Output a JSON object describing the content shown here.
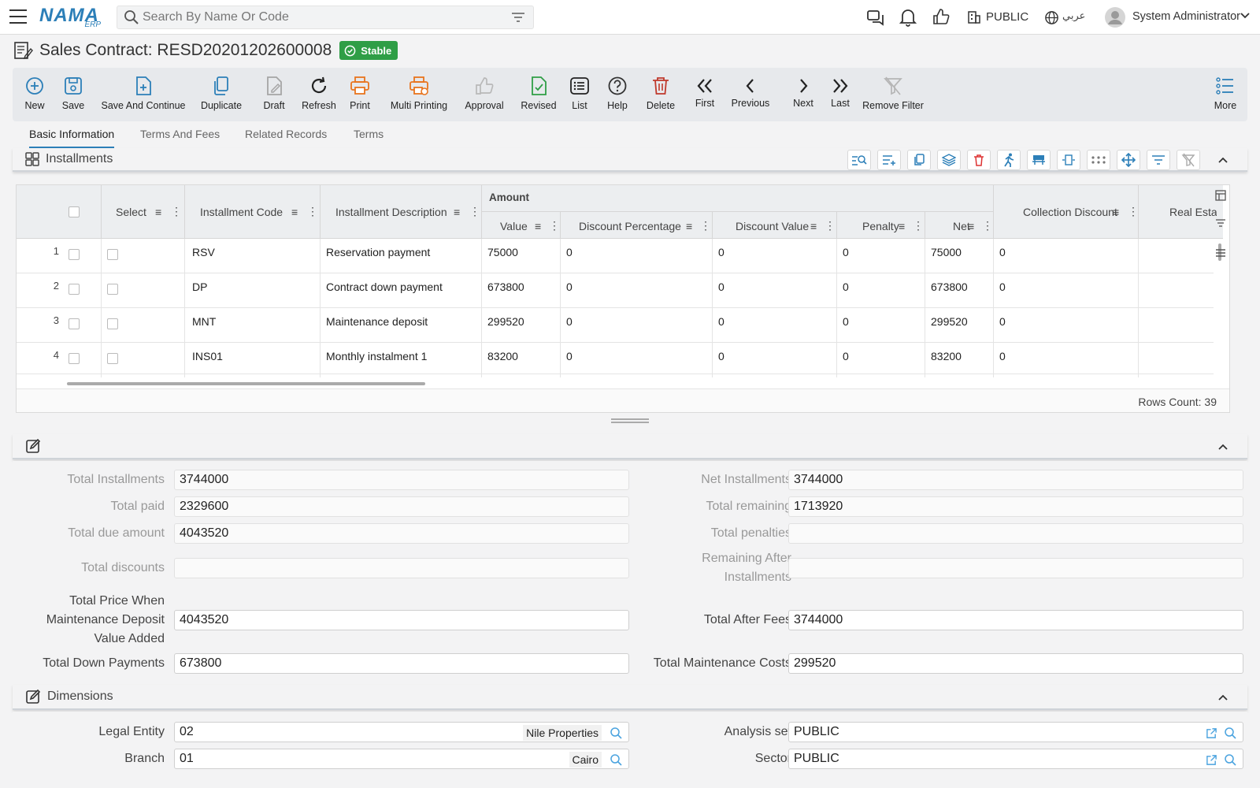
{
  "topbar": {
    "search_placeholder": "Search By Name Or Code",
    "logo_main": "NAMA",
    "logo_sub": "ERP",
    "company": "PUBLIC",
    "language": "عربي",
    "user_name": "System Administrator"
  },
  "header": {
    "title": "Sales Contract: RESD20201202600008",
    "status": "Stable",
    "status_color": "#2f9e46"
  },
  "toolbar": {
    "items": [
      {
        "label": "New",
        "icon": "plus-circle-icon",
        "color": "#2c7fb8"
      },
      {
        "label": "Save",
        "icon": "save-icon",
        "color": "#2c7fb8"
      },
      {
        "label": "Save And Continue",
        "icon": "file-plus-icon",
        "color": "#2c7fb8"
      },
      {
        "label": "Duplicate",
        "icon": "copy-icon",
        "color": "#2c7fb8"
      },
      {
        "label": "Draft",
        "icon": "edit-file-icon",
        "color": "#9a9a9a"
      },
      {
        "label": "Refresh",
        "icon": "refresh-icon",
        "color": "#222"
      },
      {
        "label": "Print",
        "icon": "printer-icon",
        "color": "#e8741e"
      },
      {
        "label": "Multi Printing",
        "icon": "multi-printer-icon",
        "color": "#e8741e"
      },
      {
        "label": "Approval",
        "icon": "thumbs-up-icon",
        "color": "#b5b5b5"
      },
      {
        "label": "Revised",
        "icon": "file-check-icon",
        "color": "#2f9e46"
      },
      {
        "label": "List",
        "icon": "list-icon",
        "color": "#222"
      },
      {
        "label": "Help",
        "icon": "help-icon",
        "color": "#333"
      },
      {
        "label": "Delete",
        "icon": "trash-icon",
        "color": "#c0392b"
      },
      {
        "label": "First",
        "icon": "chevrons-left-icon",
        "color": "#222"
      },
      {
        "label": "Previous",
        "icon": "chevron-left-icon",
        "color": "#222"
      },
      {
        "label": "Next",
        "icon": "chevron-right-icon",
        "color": "#222"
      },
      {
        "label": "Last",
        "icon": "chevrons-right-icon",
        "color": "#222"
      },
      {
        "label": "Remove Filter",
        "icon": "filter-off-icon",
        "color": "#b5b5b5"
      },
      {
        "label": "More",
        "icon": "more-list-icon",
        "color": "#2c7fb8"
      }
    ]
  },
  "tabs": [
    "Basic Information",
    "Terms And Fees",
    "Related Records",
    "Terms"
  ],
  "installments": {
    "title": "Installments",
    "group_header": "Amount",
    "columns": {
      "select": "Select",
      "code": "Installment Code",
      "description": "Installment Description",
      "value": "Value",
      "discount_percentage": "Discount Percentage",
      "discount_value": "Discount Value",
      "penalty": "Penalty",
      "net": "Net",
      "collection_discount": "Collection Discount",
      "real_estate": "Real Estate"
    },
    "rows": [
      {
        "n": "1",
        "code": "RSV",
        "desc": "Reservation payment",
        "value": "75000",
        "dp": "0",
        "dv": "0",
        "pen": "0",
        "net": "75000",
        "cd": "0"
      },
      {
        "n": "2",
        "code": "DP",
        "desc": "Contract down payment",
        "value": "673800",
        "dp": "0",
        "dv": "0",
        "pen": "0",
        "net": "673800",
        "cd": "0"
      },
      {
        "n": "3",
        "code": "MNT",
        "desc": "Maintenance deposit",
        "value": "299520",
        "dp": "0",
        "dv": "0",
        "pen": "0",
        "net": "299520",
        "cd": "0"
      },
      {
        "n": "4",
        "code": "INS01",
        "desc": "Monthly instalment 1",
        "value": "83200",
        "dp": "0",
        "dv": "0",
        "pen": "0",
        "net": "83200",
        "cd": "0"
      }
    ],
    "rows_count": "Rows Count: 39"
  },
  "totals": {
    "total_installments_label": "Total Installments",
    "total_installments": "3744000",
    "net_installments_label": "Net Installments",
    "net_installments": "3744000",
    "total_paid_label": "Total paid",
    "total_paid": "2329600",
    "total_remaining_label": "Total remaining",
    "total_remaining": "1713920",
    "total_due_label": "Total due amount",
    "total_due": "4043520",
    "total_penalties_label": "Total penalties",
    "total_penalties": "",
    "total_discounts_label": "Total discounts",
    "total_discounts": "",
    "remaining_after_label_1": "Remaining After",
    "remaining_after_label_2": "Installments",
    "remaining_after": "",
    "total_price_label_1": "Total Price When",
    "total_price_label_2": "Maintenance Deposit",
    "total_price_label_3": "Value Added",
    "total_price": "4043520",
    "total_after_fees_label": "Total After Fees",
    "total_after_fees": "3744000",
    "total_down_label": "Total Down Payments",
    "total_down": "673800",
    "total_maint_label": "Total Maintenance Costs",
    "total_maint": "299520"
  },
  "dimensions": {
    "title": "Dimensions",
    "legal_entity_label": "Legal Entity",
    "legal_entity": "02",
    "legal_entity_name": "Nile Properties",
    "analysis_set_label": "Analysis set",
    "analysis_set": "PUBLIC",
    "branch_label": "Branch",
    "branch": "01",
    "branch_name": "Cairo",
    "sector_label": "Sector",
    "sector": "PUBLIC"
  }
}
